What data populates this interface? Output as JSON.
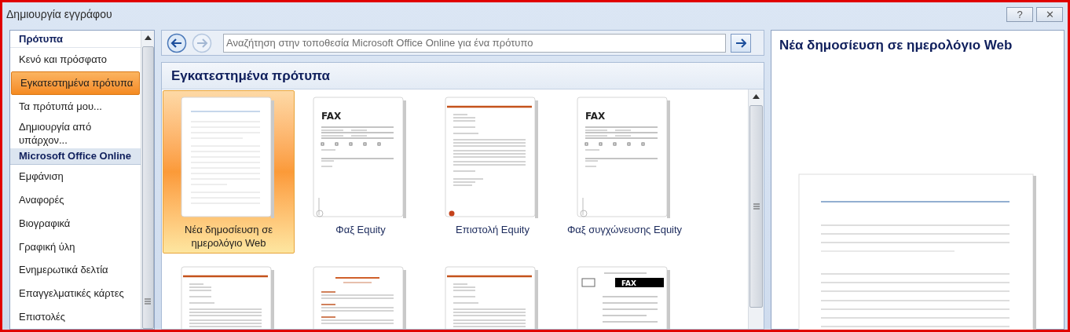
{
  "window": {
    "title": "Δημιουργία εγγράφου",
    "buttons": [
      "?",
      "✕"
    ]
  },
  "sidebar": {
    "items": [
      {
        "kind": "header",
        "label": "Πρότυπα"
      },
      {
        "kind": "item",
        "label": "Κενό και πρόσφατο",
        "selected": false
      },
      {
        "kind": "item",
        "label": "Εγκατεστημένα πρότυπα",
        "selected": true
      },
      {
        "kind": "item",
        "label": "Τα πρότυπά μου...",
        "selected": false
      },
      {
        "kind": "item",
        "label": "Δημιουργία από υπάρχον...",
        "selected": false
      },
      {
        "kind": "header",
        "label": "Microsoft Office Online"
      },
      {
        "kind": "item",
        "label": "Εμφάνιση",
        "selected": false
      },
      {
        "kind": "item",
        "label": "Αναφορές",
        "selected": false
      },
      {
        "kind": "item",
        "label": "Βιογραφικά",
        "selected": false
      },
      {
        "kind": "item",
        "label": "Γραφική ύλη",
        "selected": false
      },
      {
        "kind": "item",
        "label": "Ενημερωτικά δελτία",
        "selected": false
      },
      {
        "kind": "item",
        "label": "Επαγγελματικές κάρτες",
        "selected": false
      },
      {
        "kind": "item",
        "label": "Επιστολές",
        "selected": false
      }
    ]
  },
  "search": {
    "placeholder": "Αναζήτηση στην τοποθεσία Microsoft Office Online για ένα πρότυπο",
    "forward_disabled": true
  },
  "gallery": {
    "title": "Εγκατεστημένα πρότυπα",
    "items": [
      {
        "kind": "blank",
        "label": "Νέα δημοσίευση σε ημερολόγιο Web",
        "selected": true
      },
      {
        "kind": "fax",
        "heading": "FAX",
        "label": "Φαξ Equity",
        "selected": false
      },
      {
        "kind": "letter",
        "label": "Επιστολή Equity",
        "selected": false
      },
      {
        "kind": "fax",
        "heading": "FAX",
        "label": "Φαξ συγχώνευσης Equity",
        "selected": false
      },
      {
        "kind": "letter",
        "selected": false
      },
      {
        "kind": "report",
        "selected": false
      },
      {
        "kind": "letter",
        "selected": false
      },
      {
        "kind": "faxblack",
        "heading": "FAX",
        "selected": false
      }
    ]
  },
  "preview": {
    "title": "Νέα δημοσίευση σε ημερολόγιο Web"
  }
}
